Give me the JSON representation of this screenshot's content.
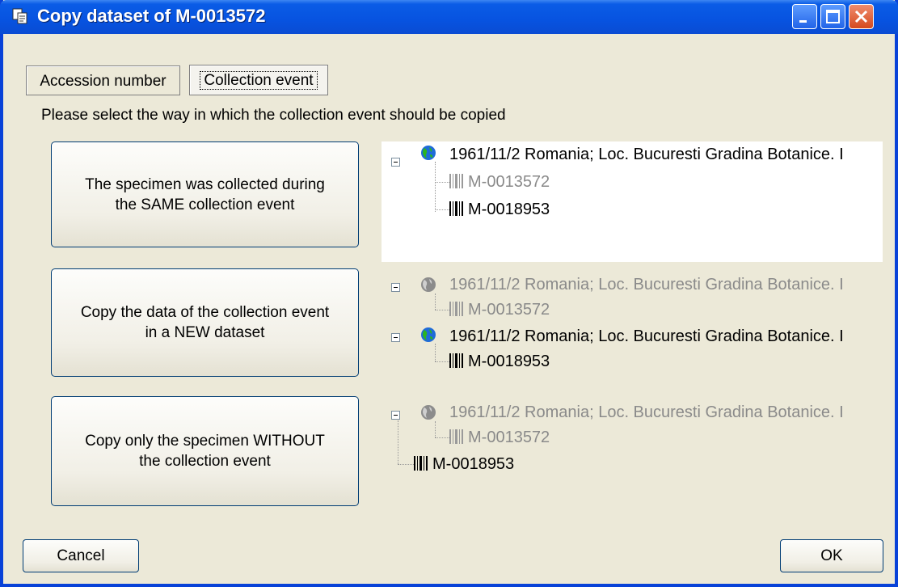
{
  "window": {
    "title": "Copy dataset of M-0013572"
  },
  "tabs": [
    {
      "label": "Accession number"
    },
    {
      "label": "Collection event"
    }
  ],
  "prompt": "Please select the way in which the collection event should be copied",
  "options": [
    {
      "label": "The specimen was collected during\nthe SAME collection event",
      "tree": [
        {
          "type": "event",
          "text": "1961/11/2 Romania; Loc. Bucuresti Gradina Botanice. I",
          "dim": false
        },
        {
          "type": "specimen",
          "text": "M-0013572",
          "dim": true
        },
        {
          "type": "specimen",
          "text": "M-0018953",
          "dim": false
        }
      ]
    },
    {
      "label": "Copy the data of the collection event\nin a NEW dataset",
      "tree": [
        {
          "type": "event",
          "text": "1961/11/2 Romania; Loc. Bucuresti Gradina Botanice. I",
          "dim": true
        },
        {
          "type": "specimen",
          "text": "M-0013572",
          "dim": true
        },
        {
          "type": "event",
          "text": "1961/11/2 Romania; Loc. Bucuresti Gradina Botanice. I",
          "dim": false
        },
        {
          "type": "specimen",
          "text": "M-0018953",
          "dim": false
        }
      ]
    },
    {
      "label": "Copy only the specimen WITHOUT\nthe collection event",
      "tree": [
        {
          "type": "event",
          "text": "1961/11/2 Romania; Loc. Bucuresti Gradina Botanice. I",
          "dim": true
        },
        {
          "type": "specimen",
          "text": "M-0013572",
          "dim": true
        },
        {
          "type": "specimen",
          "text": "M-0018953",
          "dim": false
        }
      ]
    }
  ],
  "buttons": {
    "cancel": "Cancel",
    "ok": "OK"
  },
  "colors": {
    "titlebar": "#0a5ce6",
    "window_bg": "#ece9d8",
    "dim_text": "#8a8a8a"
  },
  "icons": {
    "event": "globe-icon",
    "specimen": "barcode-icon"
  }
}
